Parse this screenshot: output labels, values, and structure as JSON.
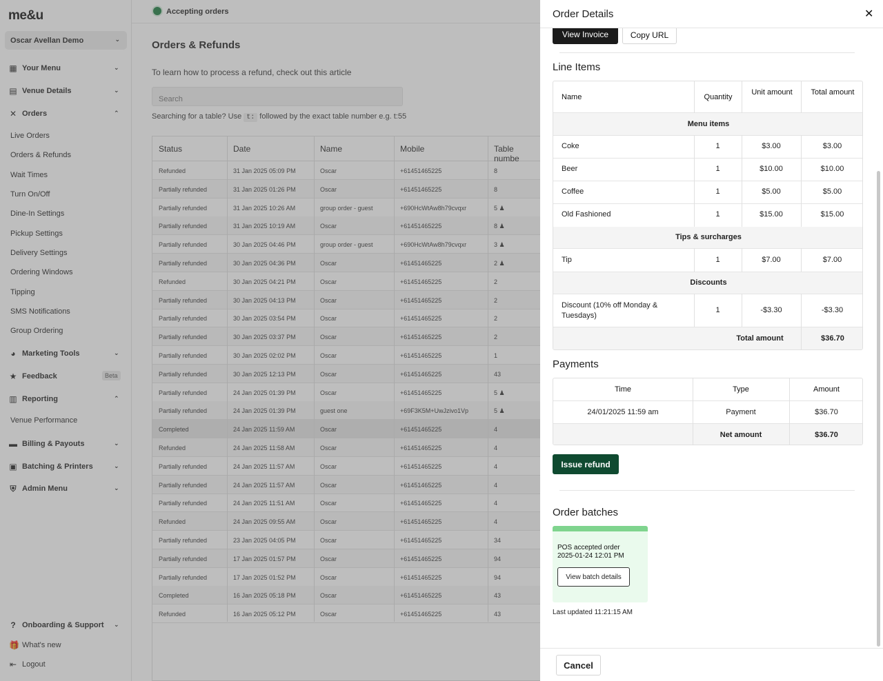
{
  "app": {
    "logo": "me&u",
    "venue": "Oscar Avellan Demo"
  },
  "sidebar": {
    "items": [
      {
        "label": "Your Menu",
        "icon": "grid-icon"
      },
      {
        "label": "Venue Details",
        "icon": "store-icon"
      },
      {
        "label": "Orders",
        "icon": "utensils-icon"
      },
      {
        "label": "Marketing Tools",
        "icon": "pie-chart-icon"
      },
      {
        "label": "Feedback",
        "icon": "star-icon",
        "badge": "Beta"
      },
      {
        "label": "Reporting",
        "icon": "bar-chart-icon"
      },
      {
        "label": "Billing & Payouts",
        "icon": "card-icon"
      },
      {
        "label": "Batching & Printers",
        "icon": "printer-icon"
      },
      {
        "label": "Admin Menu",
        "icon": "shield-icon"
      }
    ],
    "orders_sub": [
      "Live Orders",
      "Orders & Refunds",
      "Wait Times",
      "Turn On/Off",
      "Dine-In Settings",
      "Pickup Settings",
      "Delivery Settings",
      "Ordering Windows",
      "Tipping",
      "SMS Notifications",
      "Group Ordering"
    ],
    "reporting_sub": [
      "Venue Performance"
    ],
    "bottom": [
      {
        "label": "Onboarding & Support",
        "icon": "question-icon"
      },
      {
        "label": "What's new",
        "icon": "gift-icon"
      },
      {
        "label": "Logout",
        "icon": "logout-icon"
      }
    ]
  },
  "topbar": {
    "status": "Accepting orders",
    "status_color": "#1b7a3e"
  },
  "main": {
    "title": "Orders & Refunds",
    "help_text": "To learn how to process a refund, check out this article",
    "search_placeholder": "Search",
    "search_hint_before": "Searching for a table? Use",
    "search_hint_code": "t:",
    "search_hint_after": "followed by the exact table number e.g. t:55",
    "columns": [
      "Status",
      "Date",
      "Name",
      "Mobile",
      "Table numbe"
    ],
    "rows": [
      [
        "Refunded",
        "31 Jan 2025 05:09 PM",
        "Oscar",
        "+61451465225",
        "8"
      ],
      [
        "Partially refunded",
        "31 Jan 2025 01:26 PM",
        "Oscar",
        "+61451465225",
        "8"
      ],
      [
        "Partially refunded",
        "31 Jan 2025 10:26 AM",
        "group order - guest",
        "+690HcWtAw8h79cvqxr",
        "5 ♟"
      ],
      [
        "Partially refunded",
        "31 Jan 2025 10:19 AM",
        "Oscar",
        "+61451465225",
        "8 ♟"
      ],
      [
        "Partially refunded",
        "30 Jan 2025 04:46 PM",
        "group order - guest",
        "+690HcWtAw8h79cvqxr",
        "3 ♟"
      ],
      [
        "Partially refunded",
        "30 Jan 2025 04:36 PM",
        "Oscar",
        "+61451465225",
        "2 ♟"
      ],
      [
        "Refunded",
        "30 Jan 2025 04:21 PM",
        "Oscar",
        "+61451465225",
        "2"
      ],
      [
        "Partially refunded",
        "30 Jan 2025 04:13 PM",
        "Oscar",
        "+61451465225",
        "2"
      ],
      [
        "Partially refunded",
        "30 Jan 2025 03:54 PM",
        "Oscar",
        "+61451465225",
        "2"
      ],
      [
        "Partially refunded",
        "30 Jan 2025 03:37 PM",
        "Oscar",
        "+61451465225",
        "2"
      ],
      [
        "Partially refunded",
        "30 Jan 2025 02:02 PM",
        "Oscar",
        "+61451465225",
        "1"
      ],
      [
        "Partially refunded",
        "30 Jan 2025 12:13 PM",
        "Oscar",
        "+61451465225",
        "43"
      ],
      [
        "Partially refunded",
        "24 Jan 2025 01:39 PM",
        "Oscar",
        "+61451465225",
        "5 ♟"
      ],
      [
        "Partially refunded",
        "24 Jan 2025 01:39 PM",
        "guest one",
        "+69F3K5M+UwJzivo1Vp",
        "5 ♟"
      ],
      [
        "Completed",
        "24 Jan 2025 11:59 AM",
        "Oscar",
        "+61451465225",
        "4"
      ],
      [
        "Refunded",
        "24 Jan 2025 11:58 AM",
        "Oscar",
        "+61451465225",
        "4"
      ],
      [
        "Partially refunded",
        "24 Jan 2025 11:57 AM",
        "Oscar",
        "+61451465225",
        "4"
      ],
      [
        "Partially refunded",
        "24 Jan 2025 11:57 AM",
        "Oscar",
        "+61451465225",
        "4"
      ],
      [
        "Partially refunded",
        "24 Jan 2025 11:51 AM",
        "Oscar",
        "+61451465225",
        "4"
      ],
      [
        "Refunded",
        "24 Jan 2025 09:55 AM",
        "Oscar",
        "+61451465225",
        "4"
      ],
      [
        "Partially refunded",
        "23 Jan 2025 04:05 PM",
        "Oscar",
        "+61451465225",
        "34"
      ],
      [
        "Partially refunded",
        "17 Jan 2025 01:57 PM",
        "Oscar",
        "+61451465225",
        "94"
      ],
      [
        "Partially refunded",
        "17 Jan 2025 01:52 PM",
        "Oscar",
        "+61451465225",
        "94"
      ],
      [
        "Completed",
        "16 Jan 2025 05:18 PM",
        "Oscar",
        "+61451465225",
        "43"
      ],
      [
        "Refunded",
        "16 Jan 2025 05:12 PM",
        "Oscar",
        "+61451465225",
        "43"
      ]
    ],
    "selected_row": 14
  },
  "drawer": {
    "title": "Order Details",
    "view_invoice": "View Invoice",
    "copy_url": "Copy URL",
    "line_items_title": "Line Items",
    "li_headers": [
      "Name",
      "Quantity",
      "Unit amount",
      "Total amount"
    ],
    "groups": {
      "menu": "Menu items",
      "tips": "Tips & surcharges",
      "discounts": "Discounts"
    },
    "menu_items": [
      {
        "name": "Coke",
        "qty": "1",
        "unit": "$3.00",
        "total": "$3.00"
      },
      {
        "name": "Beer",
        "qty": "1",
        "unit": "$10.00",
        "total": "$10.00"
      },
      {
        "name": "Coffee",
        "qty": "1",
        "unit": "$5.00",
        "total": "$5.00"
      },
      {
        "name": "Old Fashioned",
        "qty": "1",
        "unit": "$15.00",
        "total": "$15.00"
      }
    ],
    "tips": [
      {
        "name": "Tip",
        "qty": "1",
        "unit": "$7.00",
        "total": "$7.00"
      }
    ],
    "discounts": [
      {
        "name": "Discount (10% off Monday & Tuesdays)",
        "qty": "1",
        "unit": "-$3.30",
        "total": "-$3.30"
      }
    ],
    "total_label": "Total amount",
    "total_value": "$36.70",
    "payments_title": "Payments",
    "pay_headers": [
      "Time",
      "Type",
      "Amount"
    ],
    "payment": {
      "time": "24/01/2025 11:59 am",
      "type": "Payment",
      "amount": "$36.70"
    },
    "net_label": "Net amount",
    "net_value": "$36.70",
    "issue_refund": "Issue refund",
    "batches_title": "Order batches",
    "batch_status": "POS accepted order",
    "batch_time": "2025-01-24 12:01 PM",
    "batch_button": "View batch details",
    "last_updated": "Last updated 11:21:15 AM",
    "cancel": "Cancel"
  }
}
